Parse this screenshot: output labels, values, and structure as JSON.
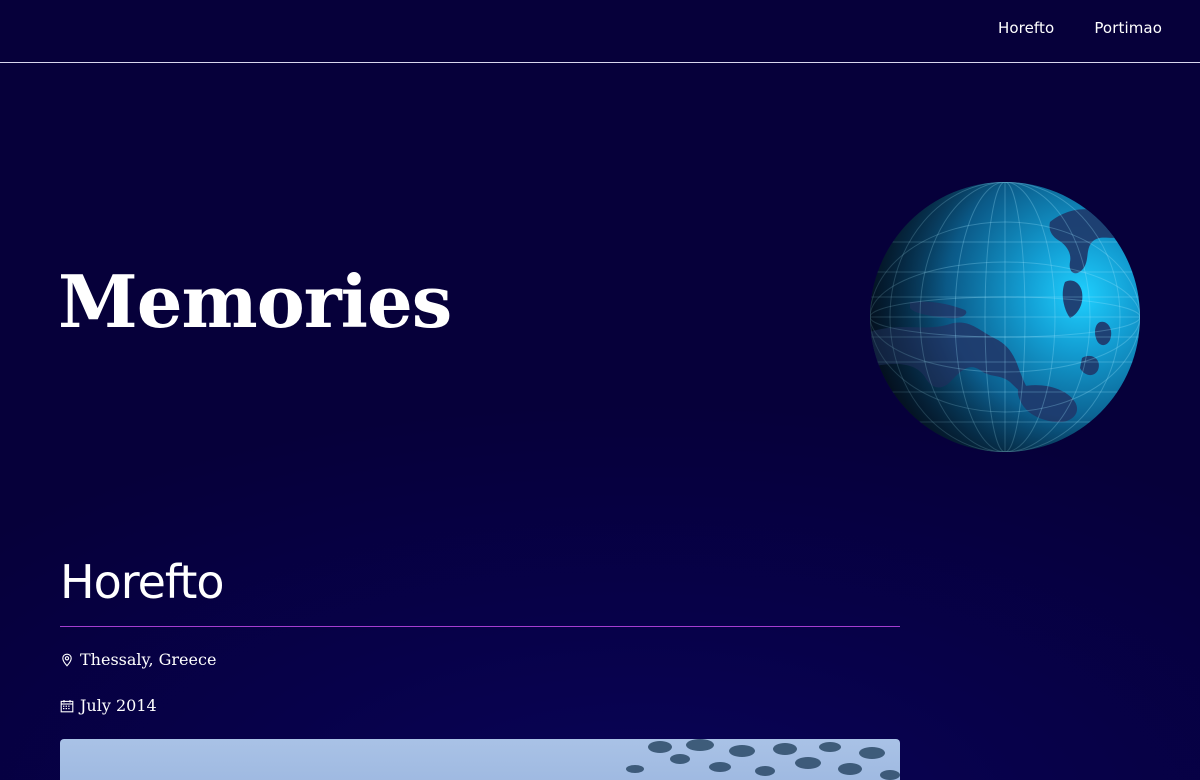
{
  "nav": {
    "links": [
      {
        "label": "Horefto"
      },
      {
        "label": "Portimao"
      }
    ]
  },
  "hero": {
    "title": "Memories",
    "globe_icon": "globe-icon"
  },
  "entry": {
    "title": "Horefto",
    "location": "Thessaly, Greece",
    "location_icon": "map-pin-icon",
    "date": "July 2014",
    "date_icon": "calendar-icon"
  },
  "colors": {
    "background": "#06003a",
    "divider": "#a43dd0",
    "globe_ocean": "#1aa5d9",
    "globe_land": "#1e3f73"
  }
}
